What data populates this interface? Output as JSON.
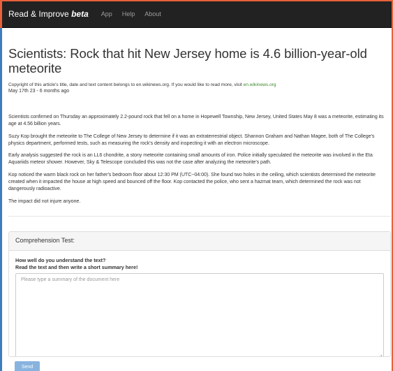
{
  "navbar": {
    "brand": "Read & Improve",
    "brand_beta": "beta",
    "links": [
      "App",
      "Help",
      "About"
    ]
  },
  "article": {
    "title": "Scientists: Rock that hit New Jersey home is 4.6 billion-year-old meteorite",
    "copyright_text": "Copyright of this article's title, date and text content belongs to en.wikinews.org. If you would like to read more, visit ",
    "copyright_link": "en.wikinews.org",
    "date": "May 17th 23 - 6 months ago",
    "paragraphs": [
      "Scientists confirmed on Thursday an approximately 2.2-pound rock that fell on a home in Hopewell Township, New Jersey, United States May 8 was a meteorite, estimating its age at 4.56 billion years.",
      "Suzy Kop brought the meteorite to The College of New Jersey to determine if it was an extraterrestrial object. Shannon Graham and Nathan Magee, both of The College's physics department, performed tests, such as measuring the rock's density and inspecting it with an electron microscope.",
      "Early analysis suggested the rock is an LL6 chondrite, a stony meteorite containing small amounts of iron. Police initially speculated the meteorite was involved in the Eta Aquariids meteor shower. However, Sky & Telescope concluded this was not the case after analyzing the meteorite's path.",
      "Kop noticed the warm black rock on her father's bedroom floor about 12:30 PM (UTC−04:00). She found two holes in the ceiling, which scientists determined the meteorite created when it impacted the house at high speed and bounced off the floor. Kop contacted the police, who sent a hazmat team, which determined the rock was not dangerously radioactive.",
      "The impact did not injure anyone."
    ]
  },
  "comprehension": {
    "heading": "Comprehension Test:",
    "question_line1": "How well do you understand the text?",
    "question_line2": "Read the text and then write a short summary here!",
    "placeholder": "Please type a summary of the document here",
    "send_label": "Send"
  },
  "colors": {
    "navbar_bg": "#222222",
    "frame_accent": "#e8613a",
    "frame_left": "#3d7dbf",
    "send_button": "#88b3de",
    "link_green": "#3a8a2a"
  }
}
